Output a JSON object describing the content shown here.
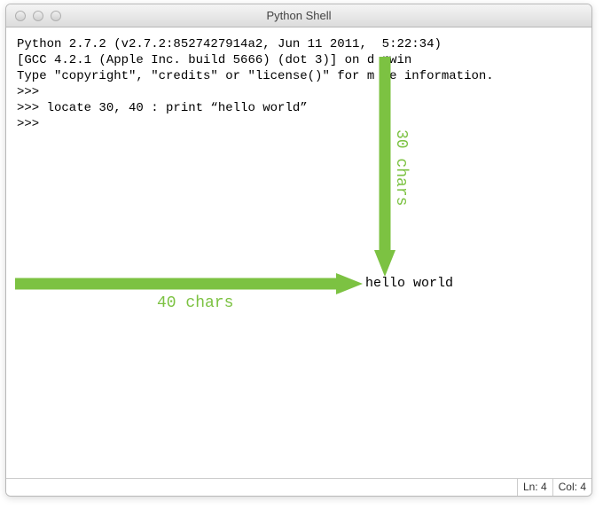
{
  "window": {
    "title": "Python Shell"
  },
  "shell": {
    "line1": "Python 2.7.2 (v2.7.2:8527427914a2, Jun 11 2011,  5:22:34)",
    "line2": "[GCC 4.2.1 (Apple Inc. build 5666) (dot 3)] on d rwin",
    "line3": "Type \"copyright\", \"credits\" or \"license()\" for m re information.",
    "prompt1": ">>>",
    "command": ">>> locate 30, 40 : print “hello world”",
    "prompt2": ">>>",
    "output": "hello world"
  },
  "annotations": {
    "vertical_label": "30 chars",
    "horizontal_label": "40 chars"
  },
  "statusbar": {
    "line": "Ln: 4",
    "col": "Col: 4"
  }
}
